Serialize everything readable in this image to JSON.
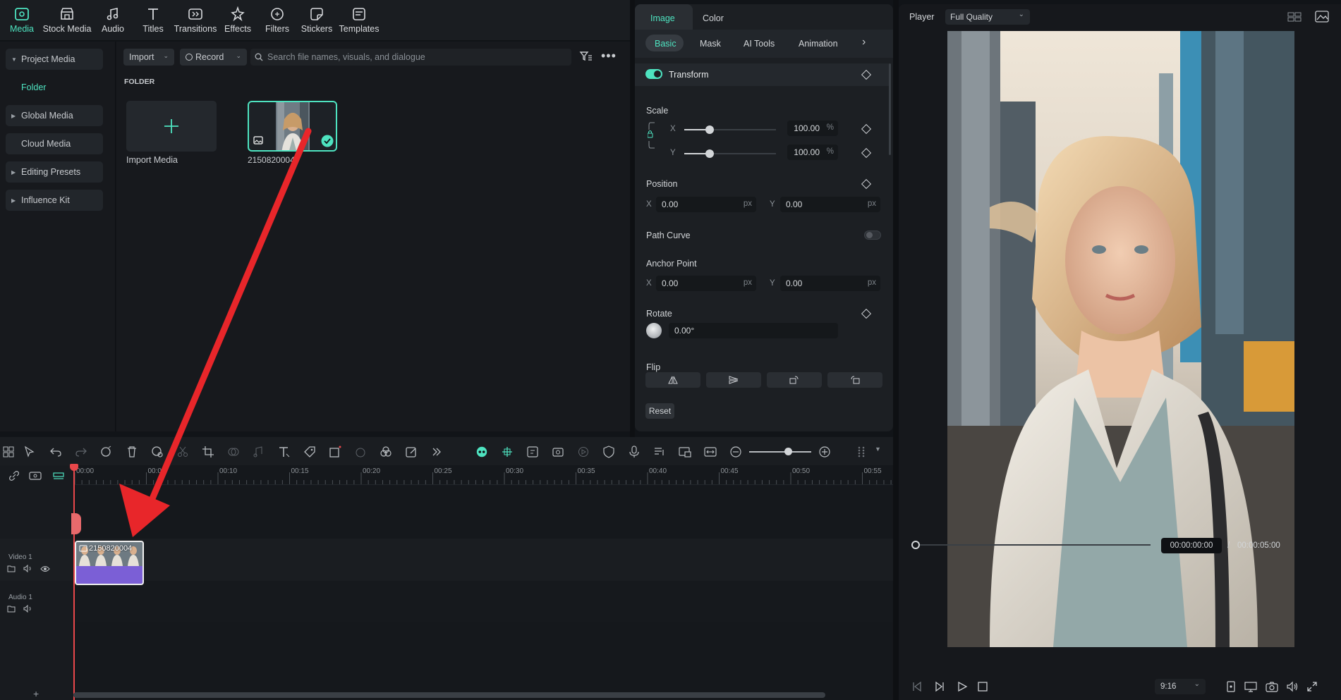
{
  "toolbar": {
    "items": [
      {
        "label": "Media",
        "icon": "media-icon"
      },
      {
        "label": "Stock Media",
        "icon": "stock-media-icon"
      },
      {
        "label": "Audio",
        "icon": "music-note-icon"
      },
      {
        "label": "Titles",
        "icon": "text-t-icon"
      },
      {
        "label": "Transitions",
        "icon": "transitions-icon"
      },
      {
        "label": "Effects",
        "icon": "effects-icon"
      },
      {
        "label": "Filters",
        "icon": "filters-icon"
      },
      {
        "label": "Stickers",
        "icon": "stickers-icon"
      },
      {
        "label": "Templates",
        "icon": "templates-icon"
      }
    ]
  },
  "sidebar": {
    "items": [
      {
        "label": "Project Media"
      },
      {
        "label": "Global Media"
      },
      {
        "label": "Cloud Media"
      },
      {
        "label": "Editing Presets"
      },
      {
        "label": "Influence Kit"
      }
    ],
    "folder_label": "Folder"
  },
  "media": {
    "import_label": "Import",
    "record_label": "Record",
    "search_placeholder": "Search file names, visuals, and dialogue",
    "section_title": "FOLDER",
    "import_tile_label": "Import Media",
    "clip_name": "2150820004"
  },
  "props": {
    "tabs": [
      "Image",
      "Color"
    ],
    "subtabs": [
      "Basic",
      "Mask",
      "AI Tools",
      "Animation"
    ],
    "transform_label": "Transform",
    "scale_label": "Scale",
    "scale_x": "100.00",
    "scale_y": "100.00",
    "percent": "%",
    "x_label": "X",
    "y_label": "Y",
    "position_label": "Position",
    "pos_x": "0.00",
    "pos_y": "0.00",
    "px": "px",
    "path_curve_label": "Path Curve",
    "anchor_label": "Anchor Point",
    "anchor_x": "0.00",
    "anchor_y": "0.00",
    "rotate_label": "Rotate",
    "rotate_value": "0.00°",
    "flip_label": "Flip",
    "reset_label": "Reset"
  },
  "player": {
    "title": "Player",
    "quality": "Full Quality",
    "current_time": "00:00:00:00",
    "separator": "/",
    "total_time": "00:00:05:00",
    "aspect": "9:16"
  },
  "timeline": {
    "ruler": [
      "00:00",
      "00:05",
      "00:10",
      "00:15",
      "00:20",
      "00:25",
      "00:30",
      "00:35",
      "00:40",
      "00:45",
      "00:50",
      "00:55"
    ],
    "video_track_label": "Video 1",
    "audio_track_label": "Audio 1",
    "clip_label": "2150820004"
  },
  "colors": {
    "accent": "#4ee3c0",
    "clip_purple": "#7b5fd6",
    "arrow_red": "#e8262a"
  }
}
